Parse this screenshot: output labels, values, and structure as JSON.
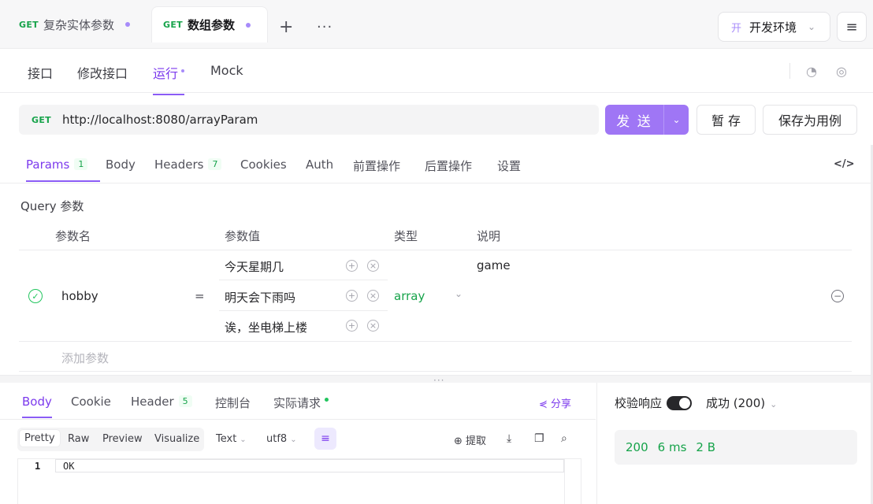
{
  "tabs": [
    {
      "method": "GET",
      "label": "复杂实体参数"
    },
    {
      "method": "GET",
      "label": "数组参数"
    }
  ],
  "tab_actions": {
    "add": "+",
    "more": "···"
  },
  "environment": {
    "badge": "开",
    "label": "开发环境"
  },
  "subnav": [
    "接口",
    "修改接口",
    "运行",
    "Mock"
  ],
  "request": {
    "method": "GET",
    "url": "http://localhost:8080/arrayParam"
  },
  "buttons": {
    "send": "发 送",
    "save_temp": "暂 存",
    "save_case": "保存为用例"
  },
  "param_tabs": [
    {
      "label": "Params",
      "count": "1"
    },
    {
      "label": "Body"
    },
    {
      "label": "Headers",
      "count": "7"
    },
    {
      "label": "Cookies"
    },
    {
      "label": "Auth"
    },
    {
      "label": "前置操作"
    },
    {
      "label": "后置操作"
    },
    {
      "label": "设置"
    }
  ],
  "code_icon": "</>",
  "query_label": "Query 参数",
  "table_headers": {
    "name": "参数名",
    "value": "参数值",
    "type": "类型",
    "desc": "说明"
  },
  "param": {
    "name": "hobby",
    "equals": "=",
    "values": [
      "今天星期几",
      "明天会下雨吗",
      "诶，坐电梯上楼"
    ],
    "type": "array",
    "desc": "game"
  },
  "add_param_placeholder": "添加参数",
  "response_tabs": [
    {
      "label": "Body"
    },
    {
      "label": "Cookie"
    },
    {
      "label": "Header",
      "count": "5"
    },
    {
      "label": "控制台"
    },
    {
      "label": "实际请求"
    }
  ],
  "share": "分享",
  "formats": [
    "Pretty",
    "Raw",
    "Preview",
    "Visualize"
  ],
  "text_select": "Text",
  "encoding_select": "utf8",
  "extract": "提取",
  "editor": {
    "line": "1",
    "text": "OK"
  },
  "verify_label": "校验响应",
  "status": "成功 (200)",
  "stats": {
    "code": "200",
    "time": "6 ms",
    "size": "2 B"
  },
  "colors": {
    "accent": "#8b5cf6",
    "method": "#16a34a",
    "send_button": "#9f76f5"
  }
}
